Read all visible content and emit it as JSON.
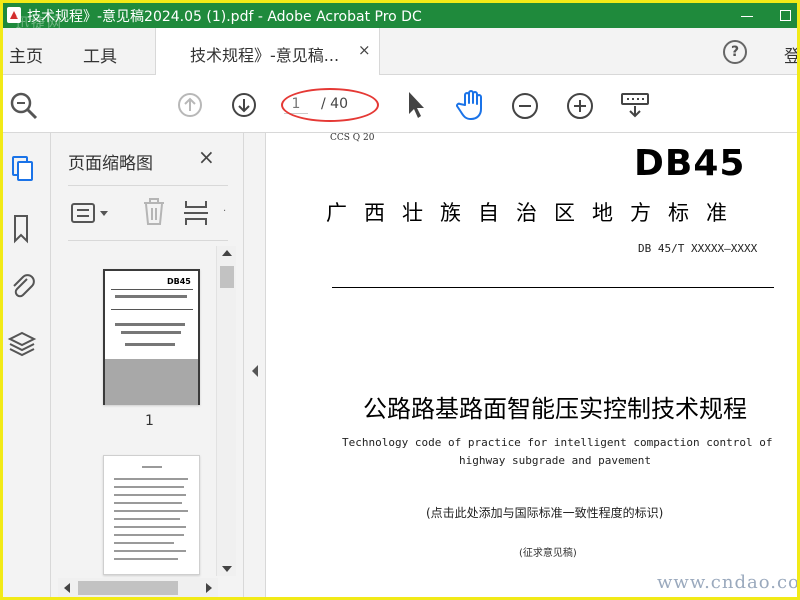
{
  "titlebar": {
    "title": "技术规程》-意见稿2024.05 (1).pdf - Adobe Acrobat Pro DC",
    "watermark": "迅捷网",
    "colors": {
      "background": "#1f8a3c",
      "text": "#ffffff"
    }
  },
  "tabbar": {
    "home": "主页",
    "tools": "工具",
    "doc_tab": "技术规程》-意见稿...",
    "doc_tab_close": "×",
    "help": "?",
    "login": "登"
  },
  "toolbar": {
    "page_current": "1",
    "page_total": "/ 40",
    "icons": [
      "zoom-search-icon",
      "prev-page-icon",
      "next-page-icon",
      "select-arrow-icon",
      "hand-icon",
      "zoom-out-icon",
      "zoom-in-icon",
      "read-mode-icon"
    ],
    "accent_color": "#1a73e8",
    "highlight_color": "#e53935"
  },
  "left_rail": {
    "icons": [
      "pages-icon",
      "bookmark-icon",
      "attachment-icon",
      "layers-icon"
    ]
  },
  "thumbnails": {
    "title": "页面缩略图",
    "close": "×",
    "page1_label": "1",
    "page1_header": "DB45"
  },
  "document": {
    "ccs": "CCS Q 20",
    "db": "DB45",
    "std_title": "广西壮族自治区地方标准",
    "std_number": "DB 45/T XXXXX—XXXX",
    "main_title": "公路路基路面智能压实控制技术规程",
    "en_title_line1": "Technology code of practice for intelligent compaction control of",
    "en_title_line2": "highway subgrade and pavement",
    "note": "(点击此处添加与国际标准一致性程度的标识)",
    "draft": "(征求意见稿)"
  },
  "watermark_bottom": "www.cndao.com"
}
